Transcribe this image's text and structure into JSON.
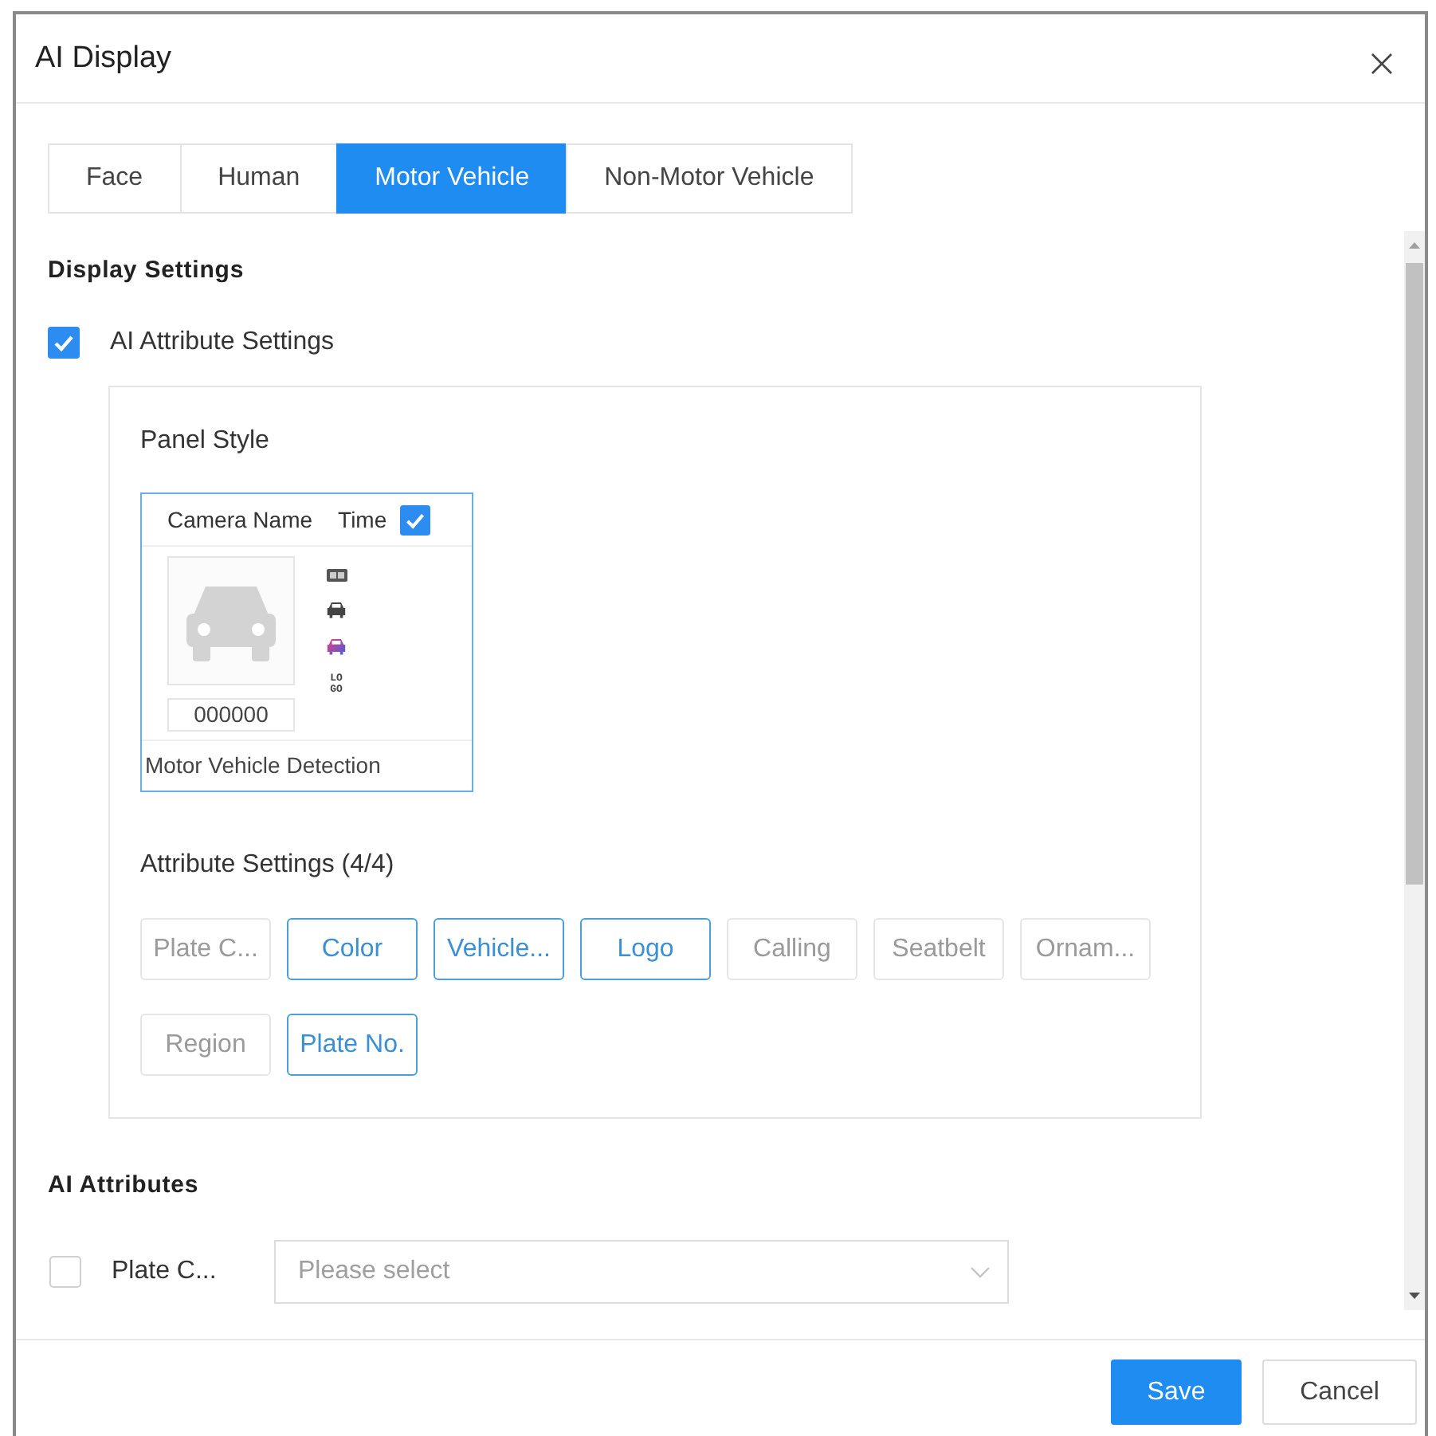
{
  "dialog": {
    "title": "AI Display"
  },
  "tabs": [
    {
      "label": "Face",
      "selected": false
    },
    {
      "label": "Human",
      "selected": false
    },
    {
      "label": "Motor Vehicle",
      "selected": true
    },
    {
      "label": "Non-Motor Vehicle",
      "selected": false
    }
  ],
  "display_settings": {
    "title": "Display Settings",
    "ai_attribute_settings": {
      "label": "AI Attribute Settings",
      "checked": true
    },
    "panel": {
      "title": "Panel Style",
      "preview": {
        "camera_name": "Camera Name",
        "time": {
          "label": "Time",
          "checked": true
        },
        "plate_number": "000000",
        "icons": [
          {
            "kind": "plate"
          },
          {
            "kind": "vehicle"
          },
          {
            "kind": "color"
          },
          {
            "kind": "logo",
            "text": "LOGO"
          }
        ],
        "caption": "Motor Vehicle Detection"
      },
      "attribute_settings": {
        "title": "Attribute Settings (4/4)",
        "options": [
          {
            "label": "Plate C...",
            "selected": false
          },
          {
            "label": "Color",
            "selected": true
          },
          {
            "label": "Vehicle...",
            "selected": true
          },
          {
            "label": "Logo",
            "selected": true
          },
          {
            "label": "Calling",
            "selected": false
          },
          {
            "label": "Seatbelt",
            "selected": false
          },
          {
            "label": "Ornam...",
            "selected": false
          },
          {
            "label": "Region",
            "selected": false
          },
          {
            "label": "Plate No.",
            "selected": true
          }
        ]
      }
    }
  },
  "ai_attributes": {
    "title": "AI Attributes",
    "rows": [
      {
        "label": "Plate C...",
        "checked": false,
        "placeholder": "Please select"
      }
    ]
  },
  "buttons": [
    {
      "label": "Save",
      "kind": "primary"
    },
    {
      "label": "Cancel",
      "kind": "default"
    }
  ]
}
